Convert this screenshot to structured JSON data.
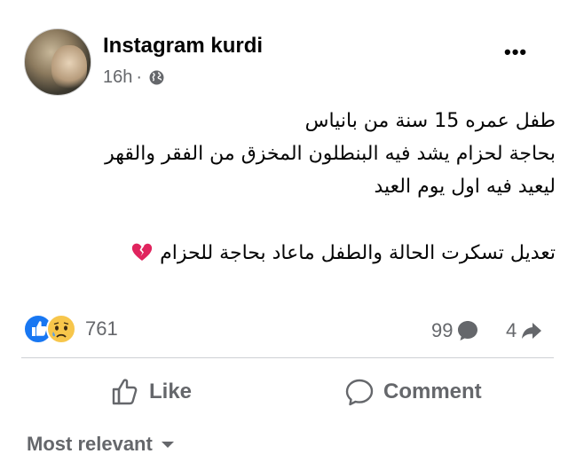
{
  "post": {
    "author": "Instagram kurdi",
    "time": "16h",
    "audience_icon": "globe-icon",
    "more_label": "•••",
    "text_lines": [
      "طفل عمره 15 سنة من بانياس",
      "بحاجة لحزام يشد فيه البنطلون المخزق من الفقر والقهر",
      "ليعيد فيه اول يوم العيد"
    ],
    "edit_line": "تعديل تسكرت الحالة والطفل ماعاد بحاجة للحزام",
    "edit_emoji": "broken-heart-icon"
  },
  "stats": {
    "reactions_count": "761",
    "reaction_icons": [
      "like-reaction-icon",
      "sad-reaction-icon"
    ],
    "comments_count": "99",
    "shares_count": "4"
  },
  "actions": {
    "like_label": "Like",
    "comment_label": "Comment"
  },
  "comments": {
    "sort_label": "Most relevant"
  },
  "colors": {
    "like_blue": "#1877f2",
    "sad_yellow": "#f7c64b",
    "heart_red": "#e0245e",
    "secondary_text": "#65676b",
    "divider": "#ced0d4"
  }
}
